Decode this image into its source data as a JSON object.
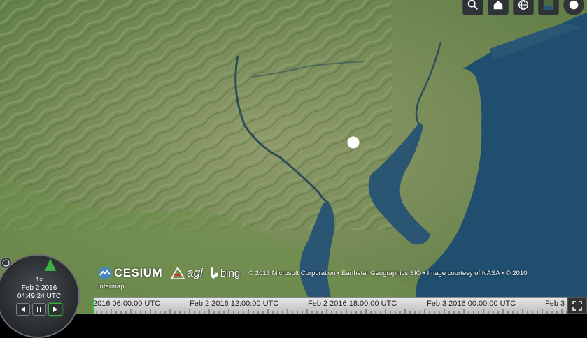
{
  "toolbar": {
    "buttons": [
      {
        "name": "geocoder-search-button",
        "icon": "search-icon"
      },
      {
        "name": "home-button",
        "icon": "home-icon"
      },
      {
        "name": "scene-mode-button",
        "icon": "globe-icon"
      },
      {
        "name": "base-layer-picker-button",
        "icon": "imagery-thumbnail-icon"
      },
      {
        "name": "help-button",
        "icon": "help-icon"
      }
    ]
  },
  "map": {
    "ocean_color": "#1f4e6e",
    "land_color": "#6f8a56",
    "marker_color": "#ffffff"
  },
  "credits": {
    "cesium_logo": "CESIUM",
    "agi_logo": "agi",
    "bing_logo": "bing",
    "attribution": "© 2016 Microsoft Corporation • Earthstar Geographics SIO • Image courtesy of NASA • © 2010",
    "intermap": "Intermap"
  },
  "animation": {
    "speed": "1x",
    "date": "Feb 2 2016",
    "time": "04:49:24 UTC",
    "accent_color": "#3cb043"
  },
  "timeline": {
    "labels": [
      "2016 06:00:00 UTC",
      "Feb 2 2016 12:00:00 UTC",
      "Feb 2 2016 18:00:00 UTC",
      "Feb 3 2016 00:00:00 UTC",
      "Feb 3"
    ]
  }
}
